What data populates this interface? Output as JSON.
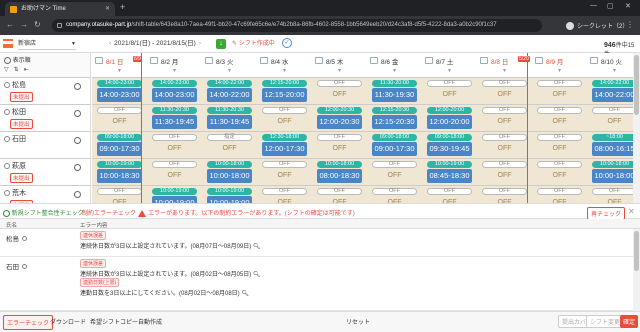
{
  "browser": {
    "tab_title": "お助けマン Time",
    "url_domain": "company.otasuke-part.jp",
    "url_path": "/shift-table/643e8a10-7aea-49f1-bb20-47c69fe65c6e/e74b2b8a-86fb-4602-8558-1bb5649eeb20/d24c3af8-d5f5-4222-8da3-a0b2c90f1c37",
    "profile_label": "シークレット（2）"
  },
  "header": {
    "store": "新宿店",
    "date_range": "2021/8/1(日) - 2021/8/15(日)",
    "shift_status": "シフト作成中",
    "count_label": "946",
    "count_suffix": "件中15件"
  },
  "controls": {
    "display_order": "表示順"
  },
  "days": [
    {
      "label": "8/1 日",
      "color": "red"
    },
    {
      "label": "8/2 月",
      "color": "normal"
    },
    {
      "label": "8/3 火",
      "color": "normal"
    },
    {
      "label": "8/4 水",
      "color": "normal"
    },
    {
      "label": "8/5 木",
      "color": "normal"
    },
    {
      "label": "8/6 金",
      "color": "normal"
    },
    {
      "label": "8/7 土",
      "color": "normal"
    },
    {
      "label": "8/8 日",
      "color": "red"
    },
    {
      "label": "8/9 月",
      "color": "red"
    },
    {
      "label": "8/10 火",
      "color": "normal"
    }
  ],
  "markers": [
    {
      "label": "6/9"
    },
    {
      "label": "5/20"
    }
  ],
  "staff": [
    {
      "name": "松島",
      "badge": "未提出",
      "cells": [
        {
          "top": "14:00-23:00",
          "main": "14:00-23:00"
        },
        {
          "top": "14:00-23:00",
          "main": "14:00-23:00"
        },
        {
          "top": "14:00-22:00",
          "main": "14:00-22:00"
        },
        {
          "top": "12:15-20:00",
          "main": "12:15-20:00"
        },
        {
          "top": "OFF",
          "main": "OFF",
          "off": true
        },
        {
          "top": "11:30-20:00",
          "main": "11:30-19:30"
        },
        {
          "top": "OFF",
          "main": "OFF",
          "off": true
        },
        {
          "top": "OFF",
          "main": "OFF",
          "off": true
        },
        {
          "top": "OFF",
          "main": "OFF",
          "off": true
        },
        {
          "top": "14:00-22:00",
          "main": "14:00-22:00"
        }
      ]
    },
    {
      "name": "松田",
      "badge": "未提出",
      "cells": [
        {
          "top": "OFF",
          "main": "OFF",
          "off": true
        },
        {
          "top": "11:30-20:30",
          "main": "11:30-19:45"
        },
        {
          "top": "11:30-20:30",
          "main": "11:30-19:45"
        },
        {
          "top": "OFF",
          "main": "OFF",
          "off": true
        },
        {
          "top": "12:00-20:30",
          "main": "12:00-20:30"
        },
        {
          "top": "12:15-20:30",
          "main": "12:15-20:30"
        },
        {
          "top": "12:00-20:00",
          "main": "12:00-20:00"
        },
        {
          "top": "OFF",
          "main": "OFF",
          "off": true
        },
        {
          "top": "OFF",
          "main": "OFF",
          "off": true
        },
        {
          "top": "OFF",
          "main": "OFF",
          "off": true
        }
      ]
    },
    {
      "name": "石田",
      "badge": "",
      "cells": [
        {
          "top": "09:00-18:00",
          "main": "09:00-17:30"
        },
        {
          "top": "OFF",
          "main": "OFF",
          "off": true
        },
        {
          "top": "指定",
          "main": "OFF",
          "off": true
        },
        {
          "top": "12:30-18:00",
          "main": "12:00-17:30"
        },
        {
          "top": "OFF",
          "main": "OFF",
          "off": true
        },
        {
          "top": "09:00-18:00",
          "main": "09:00-17:30"
        },
        {
          "top": "09:00-18:00",
          "main": "09:30-19:45"
        },
        {
          "top": "OFF",
          "main": "OFF",
          "off": true
        },
        {
          "top": "OFF",
          "main": "OFF",
          "off": true
        },
        {
          "top": "~18:00",
          "main": "08:00-16:15"
        }
      ]
    },
    {
      "name": "萩原",
      "badge": "未提出",
      "cells": [
        {
          "top": "10:00-19:00",
          "main": "10:00-18:30"
        },
        {
          "top": "OFF",
          "main": "OFF",
          "off": true
        },
        {
          "top": "10:00-18:00",
          "main": "10:00-18:00"
        },
        {
          "top": "OFF",
          "main": "OFF",
          "off": true
        },
        {
          "top": "10:00-18:00",
          "main": "08:00-18:30"
        },
        {
          "top": "OFF",
          "main": "OFF",
          "off": true
        },
        {
          "top": "10:00-19:00",
          "main": "08:45-18:30"
        },
        {
          "top": "OFF",
          "main": "OFF",
          "off": true
        },
        {
          "top": "OFF",
          "main": "OFF",
          "off": true
        },
        {
          "top": "10:00-18:00",
          "main": "10:00-18:00"
        }
      ]
    },
    {
      "name": "荒木",
      "badge": "未提出",
      "cells": [
        {
          "top": "OFF",
          "main": "OFF",
          "off": true
        },
        {
          "top": "10:00-19:00",
          "main": "10:00-19:00"
        },
        {
          "top": "10:00-19:00",
          "main": "10:00-19:00"
        },
        {
          "top": "OFF",
          "main": "OFF",
          "off": true
        },
        {
          "top": "OFF",
          "main": "OFF",
          "off": true
        },
        {
          "top": "OFF",
          "main": "OFF",
          "off": true
        },
        {
          "top": "OFF",
          "main": "OFF",
          "off": true
        },
        {
          "top": "OFF",
          "main": "OFF",
          "off": true
        },
        {
          "top": "OFF",
          "main": "OFF",
          "off": true
        },
        {
          "top": "OFF",
          "main": "OFF",
          "off": true
        }
      ]
    }
  ],
  "bottom_tabs": {
    "tab_check": "新規シフト整合性チェック",
    "tab_errors": "制約エラーチェック",
    "error_msg": "エラーがあります。以下の制約エラーがあります。(シフトの確定は可能です)",
    "recheck": "再チェック"
  },
  "errors": {
    "col_name": "氏名",
    "col_body": "エラー内容",
    "rows": [
      {
        "name": "松島",
        "tag": "連休誤差",
        "text": "連続休日数が3日以上設定されています。(08月07日～08月09日)"
      },
      {
        "name": "石田",
        "tag": "連休誤差",
        "text": "連続休日数が3日以上設定されています。(08月02日～08月05日)",
        "tag2": "連勤日数(上限)",
        "text2": "連勤日数を3日以上にしてください。(08月02日～08月08日)"
      }
    ]
  },
  "footer": {
    "error_check": "エラーチェック",
    "download": "ダウンロード",
    "copy": "希望シフトコピー",
    "auto": "自動作成",
    "reset": "リセット",
    "before": "提出カバ",
    "change": "シフト変更",
    "confirm": "確定"
  },
  "colors": {
    "accent": "#f26d3d",
    "teal": "#2bb6a6",
    "blue": "#4a86c5",
    "off_bg": "#efe7d4",
    "error": "#e74c3c"
  }
}
